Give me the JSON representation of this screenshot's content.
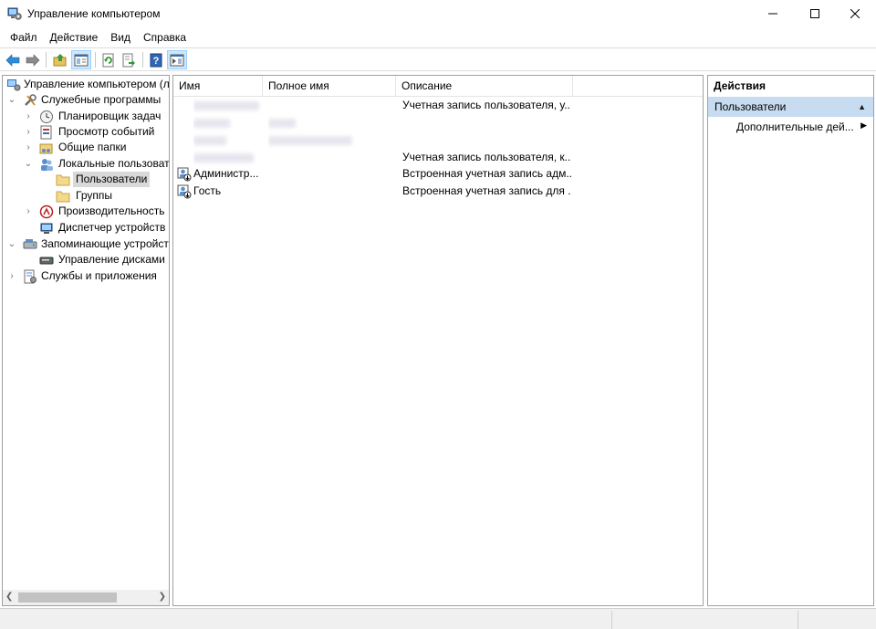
{
  "window": {
    "title": "Управление компьютером",
    "app_icon": "computer-management-icon"
  },
  "menu": [
    "Файл",
    "Действие",
    "Вид",
    "Справка"
  ],
  "toolbar": {
    "buttons": [
      "back-arrow-icon",
      "forward-arrow-icon",
      "up-folder-icon",
      "show-hide-tree-icon",
      "refresh-icon",
      "export-list-icon",
      "help-icon",
      "show-hide-action-pane-icon"
    ]
  },
  "tree": {
    "root": "Управление компьютером (л",
    "system_tools": "Служебные программы",
    "task_scheduler": "Планировщик задач",
    "event_viewer": "Просмотр событий",
    "shared_folders": "Общие папки",
    "local_users": "Локальные пользовате",
    "users": "Пользователи",
    "groups": "Группы",
    "performance": "Производительность",
    "device_manager": "Диспетчер устройств",
    "storage": "Запоминающие устройст",
    "disk_management": "Управление дисками",
    "services_apps": "Службы и приложения"
  },
  "list": {
    "columns": {
      "name": "Имя",
      "fullname": "Полное имя",
      "description": "Описание"
    },
    "rows": [
      {
        "name": "",
        "fullname": "",
        "description": "Учетная запись пользователя, у...",
        "redacted": true
      },
      {
        "name": "",
        "fullname": "",
        "description": "",
        "redacted": true
      },
      {
        "name": "",
        "fullname": "",
        "description": "",
        "redacted": true
      },
      {
        "name": "",
        "fullname": "",
        "description": "Учетная запись пользователя, к...",
        "redacted": true
      },
      {
        "name": "Администр...",
        "fullname": "",
        "description": "Встроенная учетная запись адм..."
      },
      {
        "name": "Гость",
        "fullname": "",
        "description": "Встроенная учетная запись для ..."
      }
    ]
  },
  "actions": {
    "title": "Действия",
    "section": "Пользователи",
    "more": "Дополнительные дей..."
  },
  "colors": {
    "accent_section": "#c7dcf0",
    "selection": "#d9d9d9",
    "toolbar_pressed": "#cce8ff"
  }
}
